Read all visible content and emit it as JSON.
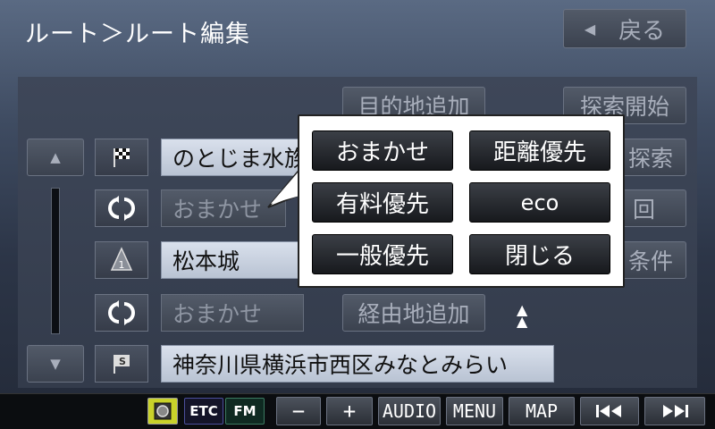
{
  "header": {
    "title": "ルート＞ルート編集",
    "back_label": "戻る"
  },
  "route": {
    "items": [
      {
        "icon": "flag-goal-icon",
        "label": "のとじま水族館",
        "style": "light"
      },
      {
        "icon": "route-type-icon",
        "label": "おまかせ",
        "style": "dark"
      },
      {
        "icon": "waypoint-1-icon",
        "label": "松本城",
        "style": "light"
      },
      {
        "icon": "route-type-icon",
        "label": "おまかせ",
        "style": "dark"
      },
      {
        "icon": "start-flag-icon",
        "label": "神奈川県横浜市西区みなとみらい",
        "style": "light"
      }
    ],
    "waypoint_number": "1",
    "start_marker": "S"
  },
  "right_buttons": {
    "add_destination": "目的地追加",
    "start_search": "探索開始",
    "search": "探索",
    "times": "回",
    "conditions": "条件",
    "add_waypoint": "経由地追加"
  },
  "popup": {
    "options": [
      "おまかせ",
      "距離優先",
      "有料優先",
      "eco",
      "一般優先",
      "閉じる"
    ]
  },
  "bottom_bar": {
    "etc": "ETC",
    "fm": "FM",
    "minus": "−",
    "plus": "+",
    "audio": "AUDIO",
    "menu": "MENU",
    "map": "MAP",
    "prev": "⏮",
    "next": "⏭"
  }
}
